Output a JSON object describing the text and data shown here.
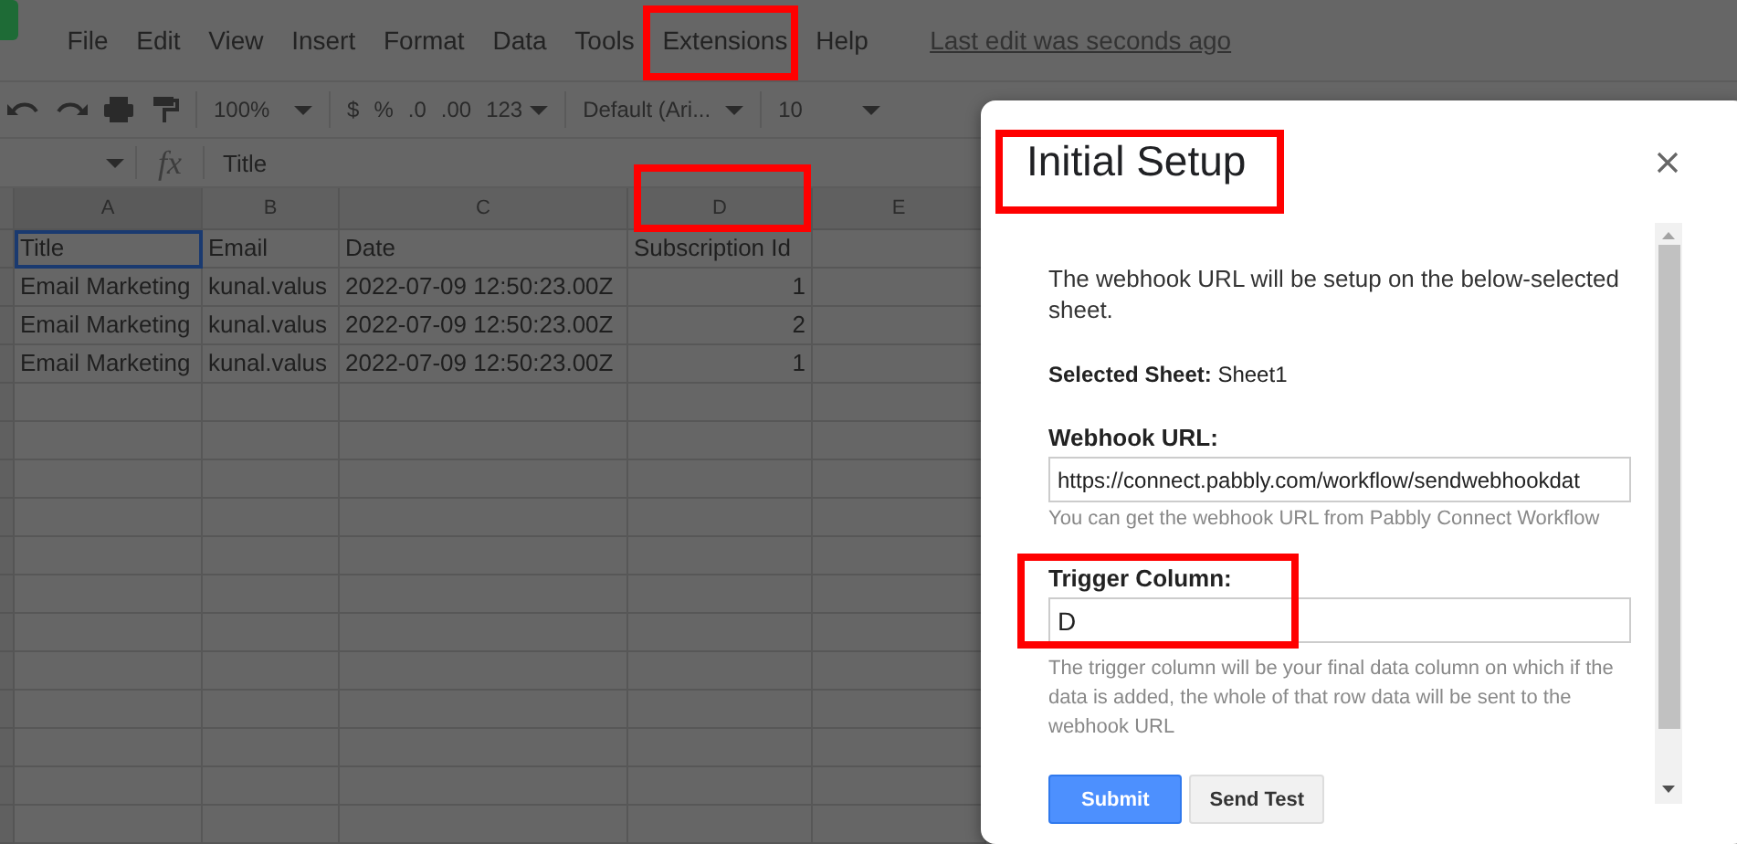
{
  "menu": {
    "items": [
      "File",
      "Edit",
      "View",
      "Insert",
      "Format",
      "Data",
      "Tools",
      "Extensions",
      "Help"
    ],
    "last_edit": "Last edit was seconds ago"
  },
  "toolbar": {
    "zoom": "100%",
    "currency": "$",
    "percent": "%",
    "decrease_decimals": ".0",
    "increase_decimals": ".00",
    "more_formats": "123",
    "font": "Default (Ari...",
    "font_size": "10"
  },
  "formula_bar": {
    "fx_label": "fx",
    "value": "Title"
  },
  "sheet": {
    "columns": [
      "A",
      "B",
      "C",
      "D",
      "E"
    ],
    "rows": [
      {
        "cells": [
          {
            "text": "Title",
            "kind": "text",
            "selected": true
          },
          {
            "text": "Email",
            "kind": "text",
            "selected": false
          },
          {
            "text": "Date",
            "kind": "text",
            "selected": false
          },
          {
            "text": "Subscription Id",
            "kind": "text",
            "selected": false
          }
        ]
      },
      {
        "cells": [
          {
            "text": "Email Marketing",
            "kind": "text",
            "selected": false
          },
          {
            "text": "kunal.valus",
            "kind": "text",
            "selected": false
          },
          {
            "text": "2022-07-09 12:50:23.00Z",
            "kind": "text",
            "selected": false
          },
          {
            "text": "1",
            "kind": "number",
            "selected": false
          }
        ]
      },
      {
        "cells": [
          {
            "text": "Email Marketing",
            "kind": "text",
            "selected": false
          },
          {
            "text": "kunal.valus",
            "kind": "text",
            "selected": false
          },
          {
            "text": "2022-07-09 12:50:23.00Z",
            "kind": "text",
            "selected": false
          },
          {
            "text": "2",
            "kind": "number",
            "selected": false
          }
        ]
      },
      {
        "cells": [
          {
            "text": "Email Marketing",
            "kind": "text",
            "selected": false
          },
          {
            "text": "kunal.valus",
            "kind": "text",
            "selected": false
          },
          {
            "text": "2022-07-09 12:50:23.00Z",
            "kind": "text",
            "selected": false
          },
          {
            "text": "1",
            "kind": "number",
            "selected": false
          }
        ]
      }
    ]
  },
  "dialog": {
    "title": "Initial Setup",
    "intro": "The webhook URL will be setup on the below-selected sheet.",
    "selected_sheet": {
      "label": "Selected Sheet:",
      "value": "Sheet1"
    },
    "fields": [
      {
        "label": "Webhook URL:",
        "value": "https://connect.pabbly.com/workflow/sendwebhookdat",
        "hint": "You can get the webhook URL from Pabbly Connect Workflow"
      },
      {
        "label": "Trigger Column:",
        "value": "D",
        "hint": "The trigger column will be your final data column on which if the data is added, the whole of that row data will be sent to the webhook URL"
      }
    ],
    "buttons": [
      {
        "label": "Submit",
        "kind": "primary"
      },
      {
        "label": "Send Test",
        "kind": "secondary"
      }
    ]
  }
}
